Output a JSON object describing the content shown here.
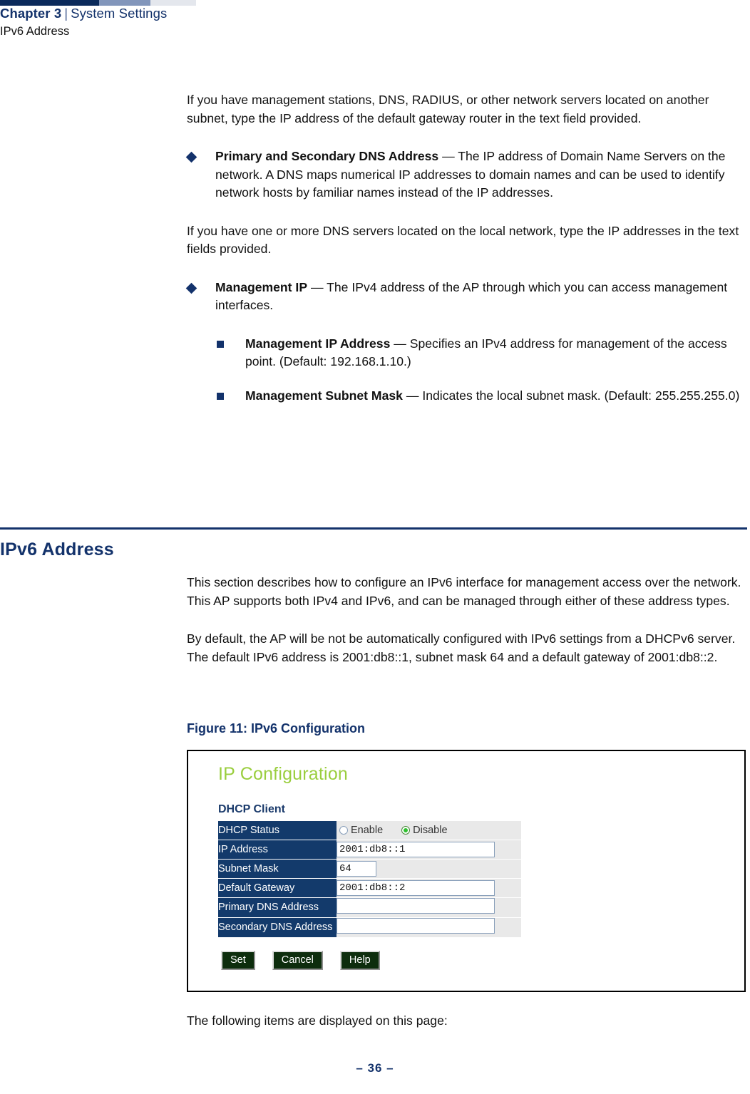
{
  "header": {
    "chapter": "Chapter 3",
    "separator": "|",
    "section": "System Settings",
    "subtitle": "IPv6 Address"
  },
  "body": {
    "para_gateway": "If you have management stations, DNS, RADIUS, or other network servers located on another subnet, type the IP address of the default gateway router in the text field provided.",
    "bullet_dns_lead": "Primary and Secondary DNS Address",
    "bullet_dns_text": " — The IP address of Domain Name Servers on the network. A DNS maps numerical IP addresses to domain names and can be used to identify network hosts by familiar names instead of the IP addresses.",
    "para_dns": "If you have one or more DNS servers located on the local network, type the IP addresses in the text fields provided.",
    "bullet_mgmt_lead": "Management IP",
    "bullet_mgmt_text": " — The IPv4 address of the AP through which you can access management interfaces.",
    "sub_mgmt_ip_lead": "Management IP Address",
    "sub_mgmt_ip_text": " — Specifies an IPv4 address for management of the access point. (Default: 192.168.1.10.)",
    "sub_mgmt_mask_lead": "Management Subnet Mask",
    "sub_mgmt_mask_text": " — Indicates the local subnet mask. (Default: 255.255.255.0)"
  },
  "section": {
    "heading": "IPv6 Address",
    "para1": "This section describes how to configure an IPv6 interface for management access over the network. This AP supports both IPv4 and IPv6, and can be managed through either of these address types.",
    "para2": "By default, the AP will be not be automatically configured with IPv6 settings from a DHCPv6 server. The default IPv6 address is 2001:db8::1, subnet mask 64 and a default gateway of 2001:db8::2.",
    "closing": "The following items are displayed on this page:"
  },
  "figure": {
    "caption": "Figure 11:  IPv6 Configuration",
    "ui": {
      "title": "IP Configuration",
      "title_color": "#9ace3e",
      "group_label": "DHCP Client",
      "rows": [
        {
          "label": "DHCP Status",
          "type": "radio",
          "value": "Disable"
        },
        {
          "label": "IP Address",
          "type": "text",
          "value": "2001:db8::1",
          "size": "wide"
        },
        {
          "label": "Subnet Mask",
          "type": "text",
          "value": "64",
          "size": "small"
        },
        {
          "label": "Default Gateway",
          "type": "text",
          "value": "2001:db8::2",
          "size": "wide"
        },
        {
          "label": "Primary DNS Address",
          "type": "text",
          "value": "",
          "size": "wide"
        },
        {
          "label": "Secondary DNS Address",
          "type": "text",
          "value": "",
          "size": "wide"
        }
      ],
      "radio_options": [
        {
          "label": "Enable",
          "selected": false
        },
        {
          "label": "Disable",
          "selected": true
        }
      ],
      "buttons": [
        "Set",
        "Cancel",
        "Help"
      ]
    }
  },
  "footer": {
    "page": "–  36  –"
  }
}
